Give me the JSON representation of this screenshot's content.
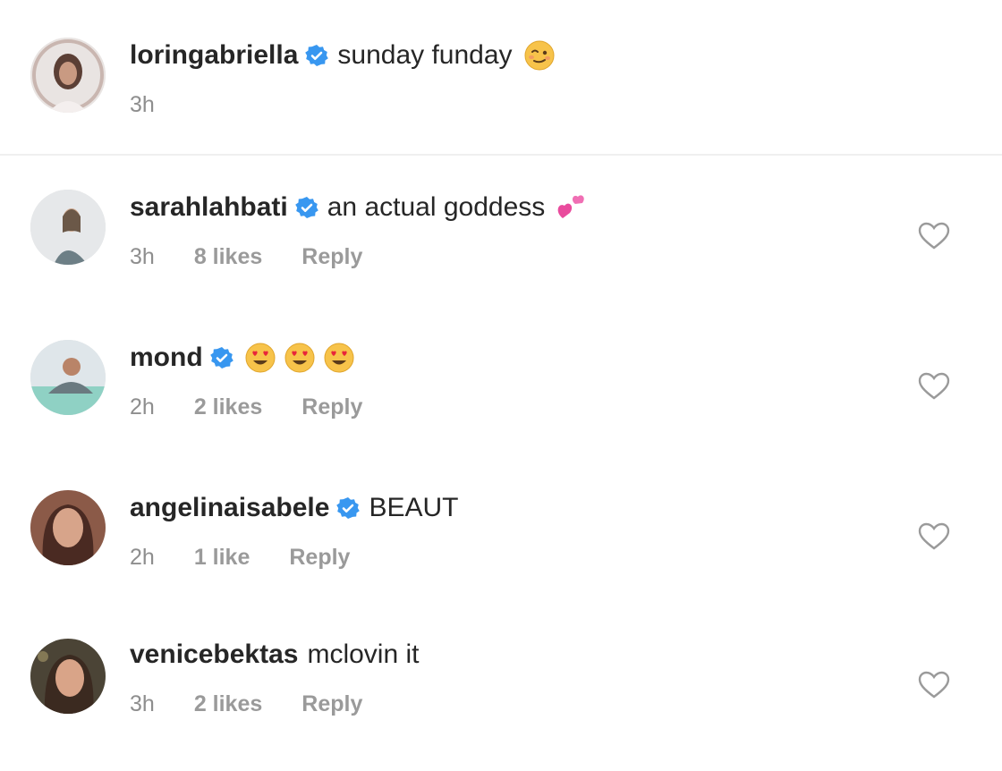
{
  "caption": {
    "username": "loringabriella",
    "verified": true,
    "text": "sunday funday",
    "emoji": "woozy-face-emoji",
    "time": "3h"
  },
  "comments": [
    {
      "username": "sarahlahbati",
      "verified": true,
      "text": "an actual goddess",
      "emoji": "two-hearts-emoji",
      "time": "3h",
      "likes": "8 likes",
      "reply": "Reply"
    },
    {
      "username": "mond",
      "verified": true,
      "text": "",
      "emoji": "heart-eyes-emoji x3",
      "time": "2h",
      "likes": "2 likes",
      "reply": "Reply"
    },
    {
      "username": "angelinaisabele",
      "verified": true,
      "text": "BEAUT",
      "time": "2h",
      "likes": "1 like",
      "reply": "Reply"
    },
    {
      "username": "venicebektas",
      "verified": false,
      "text": "mclovin it",
      "time": "3h",
      "likes": "2 likes",
      "reply": "Reply"
    }
  ],
  "colors": {
    "verified_blue": "#3897f0",
    "meta_gray": "#8e8e8e",
    "text": "#262626"
  }
}
